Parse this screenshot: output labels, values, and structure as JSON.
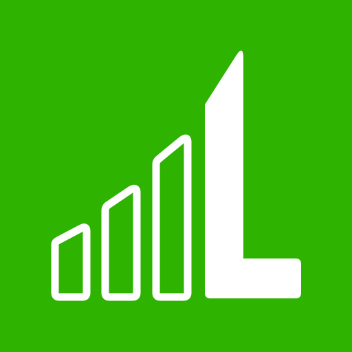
{
  "app_icon": {
    "icon_name": "signal-bars-with-letter-l-logo-icon",
    "colors": {
      "background": "#2DB300",
      "foreground": "#FFFFFF"
    }
  }
}
